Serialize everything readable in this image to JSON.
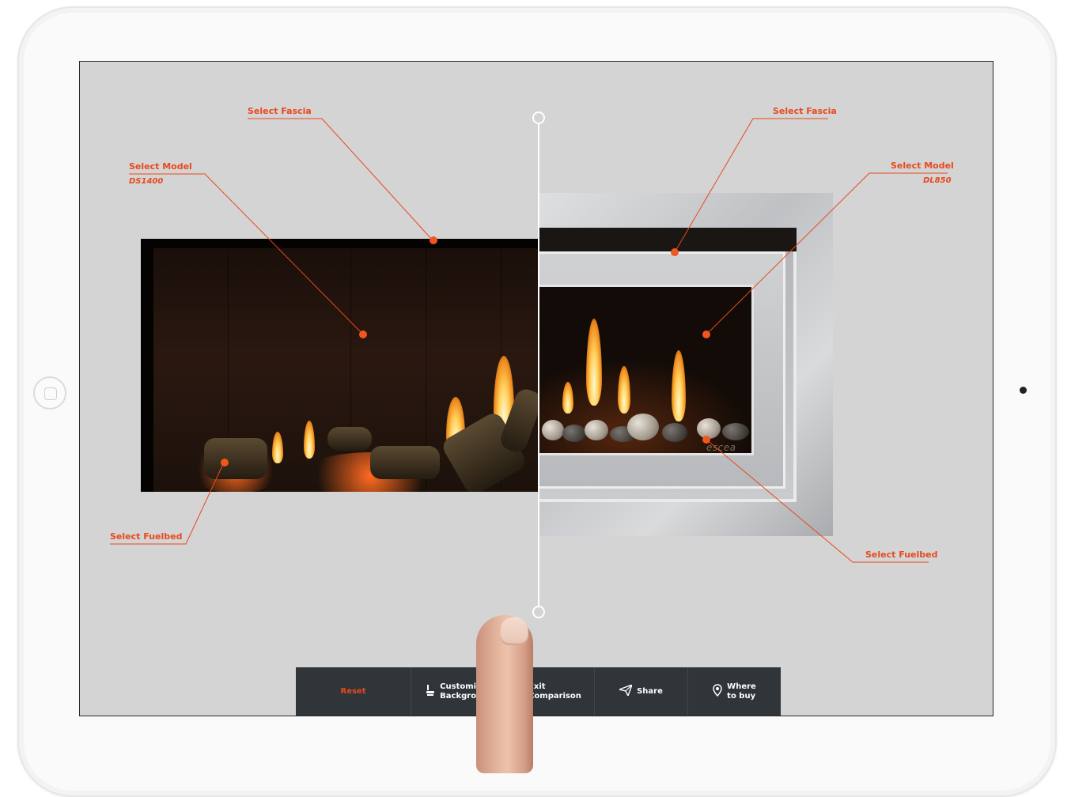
{
  "left_model": {
    "fascia_label": "Select Fascia",
    "model_label": "Select Model",
    "model_name": "DS1400",
    "fuelbed_label": "Select Fuelbed"
  },
  "right_model": {
    "fascia_label": "Select Fascia",
    "model_label": "Select Model",
    "model_name": "DL850",
    "fuelbed_label": "Select Fuelbed",
    "brand": "escea"
  },
  "toolbar": {
    "reset": "Reset",
    "customise": "Customise\nBackgrou",
    "exit": "Exit\nComparison",
    "share": "Share",
    "where": "Where\nto buy"
  },
  "icons": {
    "customise": "paint-roller-icon",
    "exit": "compare-icon",
    "share": "paper-plane-icon",
    "where": "map-pin-icon"
  },
  "colors": {
    "accent": "#e8491d",
    "toolbar_bg": "#2f3538",
    "screen_bg": "#d4d4d4"
  }
}
